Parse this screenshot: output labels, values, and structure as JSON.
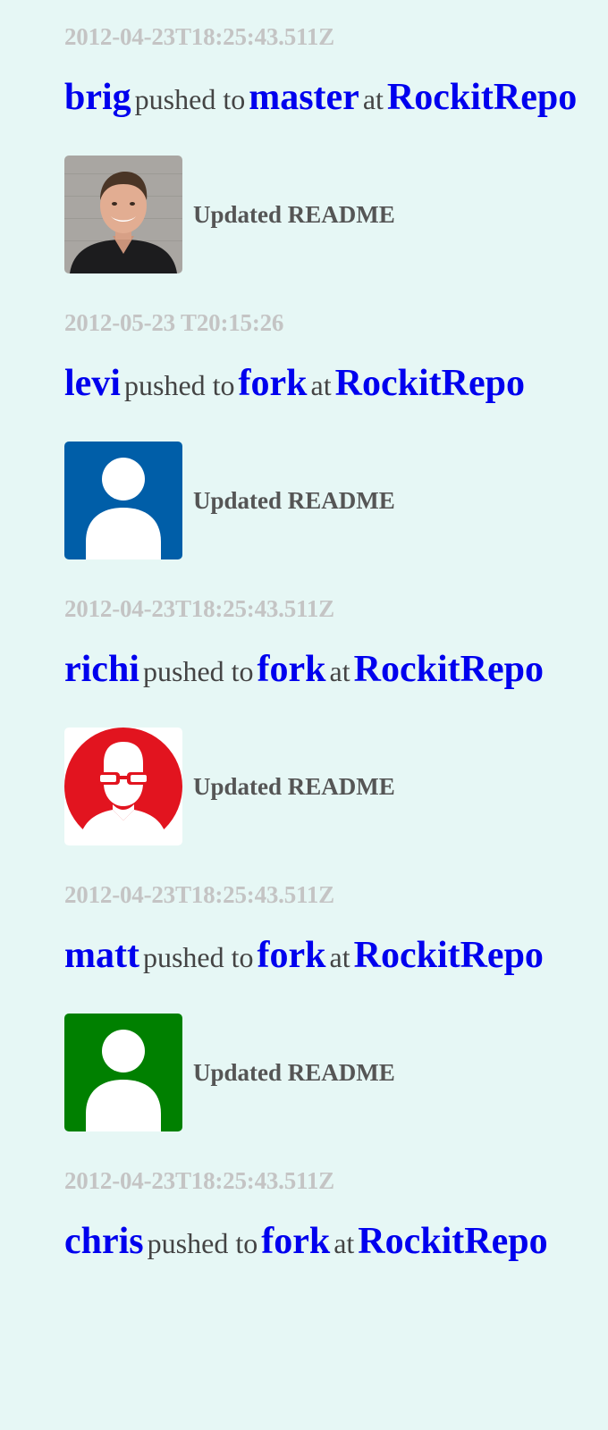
{
  "events": [
    {
      "timestamp": "2012-04-23T18:25:43.511Z",
      "user": "brig",
      "pushed_to": "pushed to",
      "branch": "master",
      "at": "at",
      "repo": "RockitRepo",
      "avatar": "photo-avatar",
      "message": "Updated README"
    },
    {
      "timestamp": "2012-05-23 T20:15:26",
      "user": "levi",
      "pushed_to": "pushed to",
      "branch": "fork",
      "at": "at",
      "repo": "RockitRepo",
      "avatar": "default-user-icon",
      "avatar_color": "#005ea8",
      "message": "Updated README"
    },
    {
      "timestamp": "2012-04-23T18:25:43.511Z",
      "user": "richi",
      "pushed_to": "pushed to",
      "branch": "fork",
      "at": "at",
      "repo": "RockitRepo",
      "avatar": "glasses-user-icon",
      "avatar_color": "#e2141f",
      "message": "Updated README"
    },
    {
      "timestamp": "2012-04-23T18:25:43.511Z",
      "user": "matt",
      "pushed_to": "pushed to",
      "branch": "fork",
      "at": "at",
      "repo": "RockitRepo",
      "avatar": "default-user-icon",
      "avatar_color": "#008000",
      "message": "Updated README"
    },
    {
      "timestamp": "2012-04-23T18:25:43.511Z",
      "user": "chris",
      "pushed_to": "pushed to",
      "branch": "fork",
      "at": "at",
      "repo": "RockitRepo"
    }
  ]
}
